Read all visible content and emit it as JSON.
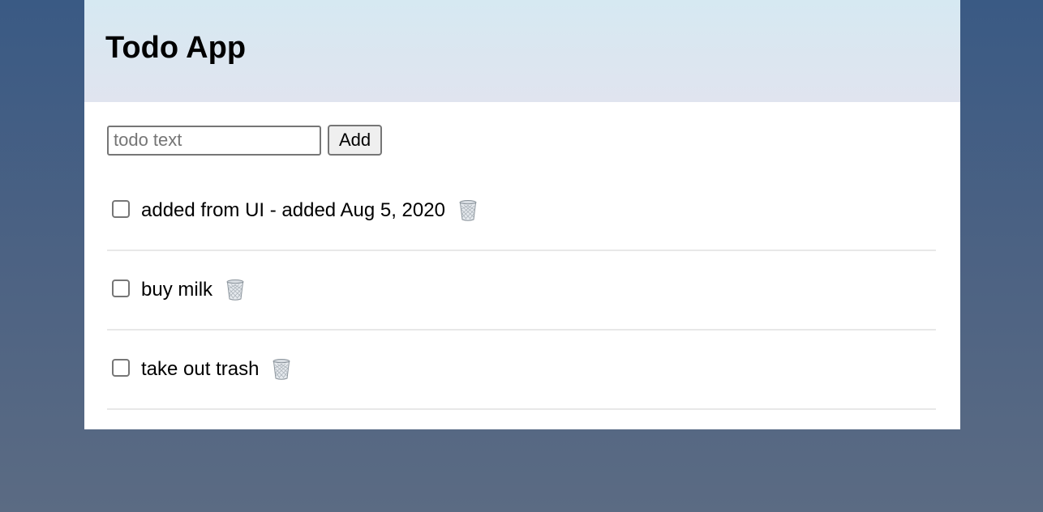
{
  "header": {
    "title": "Todo App"
  },
  "new_todo": {
    "placeholder": "todo text",
    "value": "",
    "add_label": "Add"
  },
  "todos": [
    {
      "text": "added from UI - added Aug 5, 2020",
      "completed": false,
      "delete_icon": "wastebasket-icon"
    },
    {
      "text": "buy milk",
      "completed": false,
      "delete_icon": "wastebasket-icon"
    },
    {
      "text": "take out trash",
      "completed": false,
      "delete_icon": "wastebasket-icon"
    }
  ],
  "colors": {
    "background_top": "#3a5a84",
    "background_bottom": "#5b6b83",
    "header_top": "#d6e9f2",
    "header_bottom": "#e0e4ef",
    "panel": "#ffffff",
    "divider": "#e8e8e8"
  }
}
